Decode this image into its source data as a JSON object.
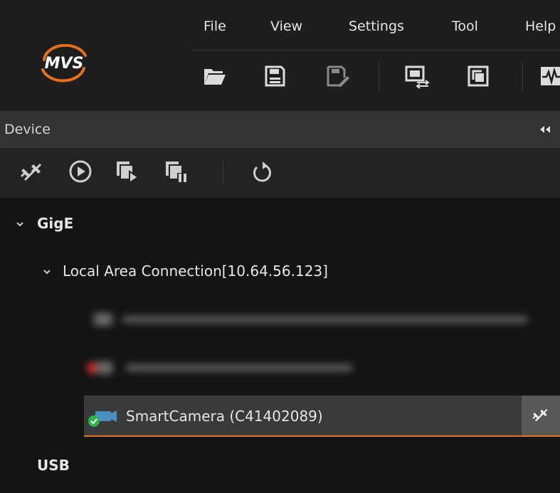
{
  "menu": {
    "items": [
      "File",
      "View",
      "Settings",
      "Tool",
      "Help"
    ]
  },
  "logo": {
    "text": "MVS",
    "accent": "#e8701a"
  },
  "toolbar": {
    "icons": [
      "open-folder-icon",
      "save-icon",
      "save-as-icon",
      "window-switch-icon",
      "fullscreen-icon",
      "waveform-icon"
    ]
  },
  "device_panel": {
    "title": "Device",
    "collapse_icon": "double-left-arrow-icon",
    "tools": [
      "disconnect-icon",
      "play-circle-icon",
      "start-grab-icon",
      "stop-grab-icon",
      "refresh-icon"
    ]
  },
  "tree": {
    "gige_label": "GigE",
    "connection_label": "Local Area Connection[10.64.56.123]",
    "selected_device_label": "SmartCamera (C41402089)",
    "usb_label": "USB"
  },
  "colors": {
    "accent": "#e8701a",
    "status_ok": "#2fb44a",
    "status_error": "#d0302e",
    "camera_icon": "#4a8fc2"
  }
}
